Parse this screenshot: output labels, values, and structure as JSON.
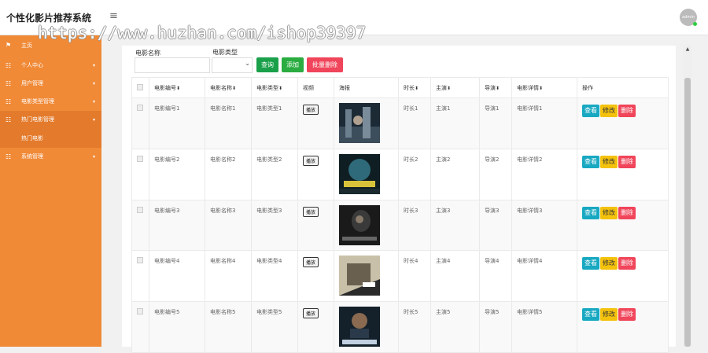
{
  "app": {
    "title": "个性化影片推荐系统",
    "menu_toggle": "≡",
    "avatar_label": "admin"
  },
  "watermark": "https://www.huzhan.com/ishop39397",
  "sidebar": {
    "items": [
      {
        "label": "主页",
        "icon": "flag-icon"
      },
      {
        "label": "个人中心",
        "icon": "list-icon",
        "chev": "▾"
      },
      {
        "label": "用户管理",
        "icon": "list-icon",
        "chev": "▾"
      },
      {
        "label": "电影类型管理",
        "icon": "list-icon",
        "chev": "▾"
      },
      {
        "label": "热门电影管理",
        "icon": "list-icon",
        "chev": "▾"
      },
      {
        "label": "系统管理",
        "icon": "list-icon",
        "chev": "▾"
      }
    ],
    "sub_item": "热门电影"
  },
  "filters": {
    "name_label": "电影名称",
    "type_label": "电影类型",
    "select_arrow": "⌄"
  },
  "buttons": {
    "search": "查询",
    "add": "添加",
    "batch_delete": "批量删除"
  },
  "colors": {
    "sidebar": "#f08a37",
    "search": "#1aa04a",
    "add": "#2aac40",
    "batch_delete": "#f0455a",
    "view": "#18a8c1",
    "edit": "#f4c20d",
    "delete": "#f0455a"
  },
  "table": {
    "columns": [
      "电影编号",
      "电影名称",
      "电影类型",
      "视频",
      "海报",
      "时长",
      "主演",
      "导演",
      "电影详情",
      "操作"
    ],
    "sort_mark": "⬍",
    "play_label": "播放",
    "actions": {
      "view": "查看",
      "edit": "修改",
      "delete": "删除"
    },
    "rows": [
      {
        "id": "电影编号1",
        "name": "电影名称1",
        "type": "电影类型1",
        "duration": "时长1",
        "actor": "主演1",
        "director": "导演1",
        "detail": "电影详情1"
      },
      {
        "id": "电影编号2",
        "name": "电影名称2",
        "type": "电影类型2",
        "duration": "时长2",
        "actor": "主演2",
        "director": "导演2",
        "detail": "电影详情2"
      },
      {
        "id": "电影编号3",
        "name": "电影名称3",
        "type": "电影类型3",
        "duration": "时长3",
        "actor": "主演3",
        "director": "导演3",
        "detail": "电影详情3"
      },
      {
        "id": "电影编号4",
        "name": "电影名称4",
        "type": "电影类型4",
        "duration": "时长4",
        "actor": "主演4",
        "director": "导演4",
        "detail": "电影详情4"
      },
      {
        "id": "电影编号5",
        "name": "电影名称5",
        "type": "电影类型5",
        "duration": "时长5",
        "actor": "主演5",
        "director": "导演5",
        "detail": "电影详情5"
      }
    ]
  },
  "scrollbar": {
    "up_arrow": "▲"
  }
}
